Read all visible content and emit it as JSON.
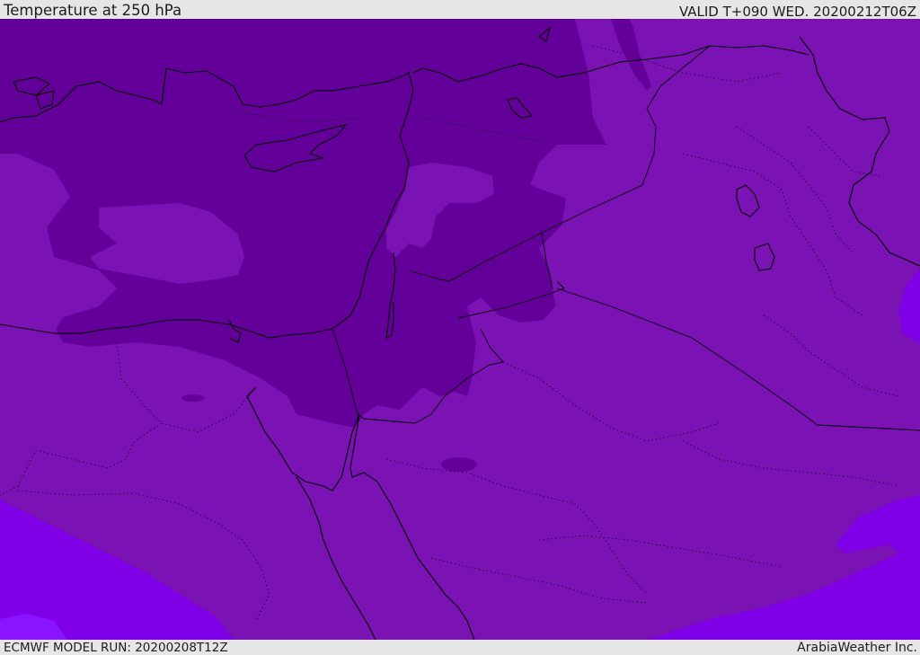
{
  "header": {
    "title": "Temperature at 250 hPa",
    "valid": "VALID T+090 WED. 20200212T06Z"
  },
  "footer": {
    "model_run": "ECMWF MODEL RUN: 20200208T12Z",
    "credit": "ArabiaWeather Inc."
  },
  "colors": {
    "coldest_band": "#64009a",
    "mid_band": "#7a12b4",
    "warm_band": "#7f00e6",
    "warmest_band": "#8a14ff",
    "coastline": "#000000",
    "header_bg": "#e6e6e6"
  }
}
